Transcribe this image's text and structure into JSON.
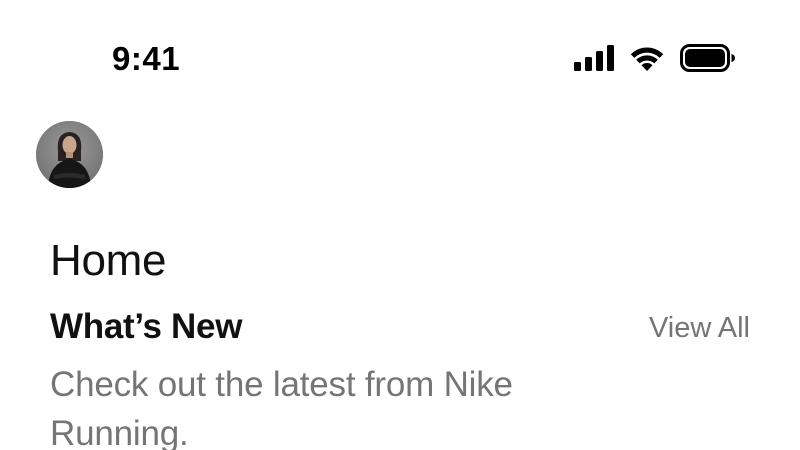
{
  "status_bar": {
    "time": "9:41",
    "icons": [
      "cellular-signal-icon",
      "wifi-icon",
      "battery-icon"
    ]
  },
  "profile": {
    "avatar": "user-avatar"
  },
  "page": {
    "title": "Home"
  },
  "whats_new": {
    "title": "What’s New",
    "view_all_label": "View All",
    "description": "Check out the latest from Nike Running."
  },
  "colors": {
    "primary_text": "#111111",
    "secondary_text": "#757575",
    "background": "#ffffff"
  }
}
